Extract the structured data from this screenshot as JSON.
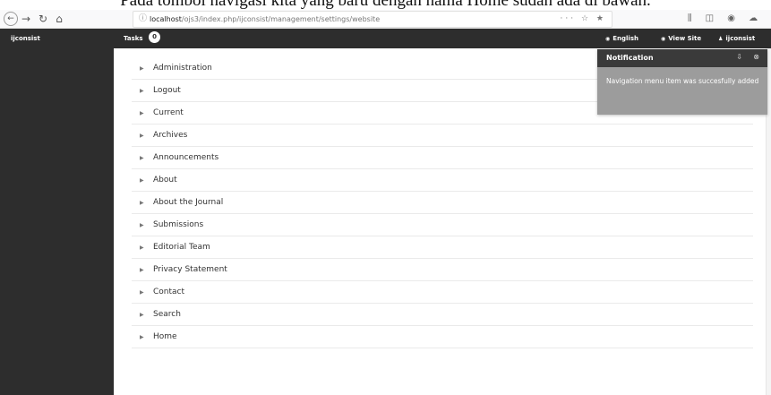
{
  "caption": "Pada tombol navigasi kita yang baru dengan nama Home sudah ada di bawah.",
  "browser": {
    "back_icon": "back-arrow-icon",
    "forward_glyph": "→",
    "reload_glyph": "↻",
    "home_glyph": "⌂",
    "url_host": "localhost",
    "url_path": "/ojs3/index.php/ijconsist/management/settings/website",
    "url_actions": "··· ☆ ★",
    "right_icons": "⫼ ◫ ◉ ☁ ◍ ≡"
  },
  "navbar": {
    "brand": "ijconsist",
    "tasks_label": "Tasks",
    "tasks_count": "0",
    "language_label": "English",
    "view_site_label": "View Site",
    "user_label": "ijconsist"
  },
  "menu": {
    "items": [
      {
        "label": "Administration"
      },
      {
        "label": "Logout"
      },
      {
        "label": "Current"
      },
      {
        "label": "Archives"
      },
      {
        "label": "Announcements"
      },
      {
        "label": "About"
      },
      {
        "label": "About the Journal"
      },
      {
        "label": "Submissions"
      },
      {
        "label": "Editorial Team"
      },
      {
        "label": "Privacy Statement"
      },
      {
        "label": "Contact"
      },
      {
        "label": "Search"
      },
      {
        "label": "Home"
      }
    ]
  },
  "notification": {
    "title": "Notification",
    "message": "Navigation menu item was succesfully added"
  },
  "colors": {
    "navbar_bg": "#2d2d2d",
    "notification_bg": "#9c9c9c",
    "notification_header_bg": "#3a3a3a"
  }
}
